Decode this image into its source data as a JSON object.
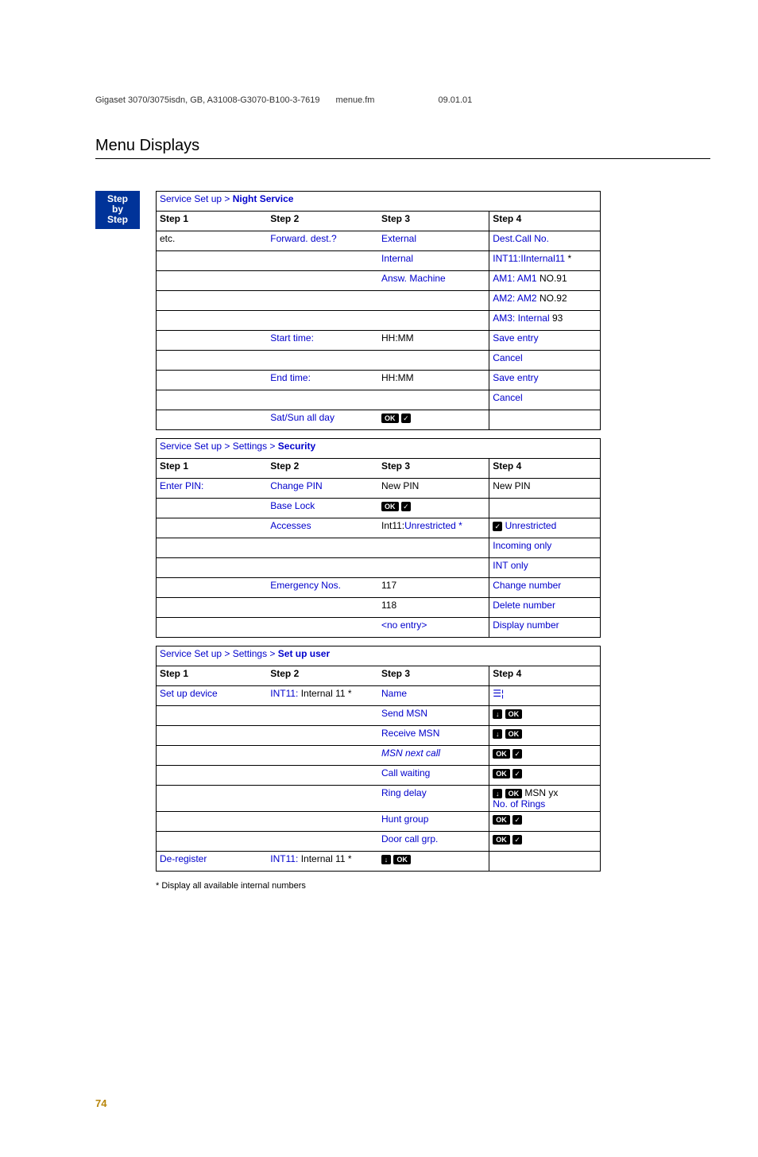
{
  "header": {
    "doc": "Gigaset 3070/3075isdn, GB, A31008-G3070-B100-3-7619",
    "file": "menue.fm",
    "date": "09.01.01"
  },
  "section_title": "Menu Displays",
  "badge": {
    "l1": "Step",
    "l2": "by",
    "l3": "Step"
  },
  "table1": {
    "title_a": "Service Set up > ",
    "title_b": "Night Service",
    "head": [
      "Step 1",
      "Step 2",
      "Step 3",
      "Step 4"
    ],
    "rows": [
      {
        "c1": "etc.",
        "c2": "Forward. dest.?",
        "c3": "External",
        "c4": "Dest.Call No."
      },
      {
        "c1": "",
        "c2": "",
        "c3": "Internal",
        "c4_a": "INT11:IInternal11 ",
        "c4_b": "*"
      },
      {
        "c1": "",
        "c2": "",
        "c3": "Answ. Machine",
        "c4_a": "AM1: AM1 ",
        "c4_b": "NO.91"
      },
      {
        "c1": "",
        "c2": "",
        "c3": "",
        "c4_a": "AM2: AM2 ",
        "c4_b": "NO.92"
      },
      {
        "c1": "",
        "c2": "",
        "c3": "",
        "c4_a": "AM3: Internal ",
        "c4_b": "93"
      },
      {
        "c1": "",
        "c2": "Start time:",
        "c3": "HH:MM",
        "c4": "Save entry"
      },
      {
        "c1": "",
        "c2": "",
        "c3": "",
        "c4": "Cancel"
      },
      {
        "c1": "",
        "c2": "End time:",
        "c3": "HH:MM",
        "c4": "Save entry"
      },
      {
        "c1": "",
        "c2": "",
        "c3": "",
        "c4": "Cancel"
      },
      {
        "c1": "",
        "c2": "Sat/Sun all day",
        "c3_icon": "okcheck",
        "c4": ""
      }
    ]
  },
  "table2": {
    "title_a": "Service Set up > Settings > ",
    "title_b": "Security",
    "head": [
      "Step 1",
      "Step 2",
      "Step 3",
      "Step 4"
    ],
    "rows": [
      {
        "c1": "Enter PIN:",
        "c2": "Change PIN",
        "c3": "New PIN",
        "c4": "New PIN"
      },
      {
        "c1": "",
        "c2": "Base Lock",
        "c3_icon": "okcheck",
        "c4": ""
      },
      {
        "c1": "",
        "c2": "Accesses",
        "c3_a": "Int11:",
        "c3_b": "Unrestricted *",
        "c4_pre": "check",
        "c4": " Unrestricted"
      },
      {
        "c1": "",
        "c2": "",
        "c3": "",
        "c4": "Incoming only"
      },
      {
        "c1": "",
        "c2": "",
        "c3": "",
        "c4": "INT only"
      },
      {
        "c1": "",
        "c2": "Emergency Nos.",
        "c3": "117",
        "c4": "Change number"
      },
      {
        "c1": "",
        "c2": "",
        "c3": "118",
        "c4": "Delete number"
      },
      {
        "c1": "",
        "c2": "",
        "c3": "<no entry>",
        "c4": "Display number"
      }
    ]
  },
  "table3": {
    "title_a": "Service Set up > Settings > ",
    "title_b": "Set up user",
    "head": [
      "Step 1",
      "Step 2",
      "Step 3",
      "Step 4"
    ],
    "rows": [
      {
        "c1": "Set up device",
        "c2_a": "INT11: ",
        "c2_b": "Internal 11 *",
        "c3": "Name",
        "c4_icon": "texticon"
      },
      {
        "c1": "",
        "c2": "",
        "c3": "Send MSN",
        "c4_icon": "arrowok"
      },
      {
        "c1": "",
        "c2": "",
        "c3": "Receive MSN",
        "c4_icon": "arrowok"
      },
      {
        "c1": "",
        "c2": "",
        "c3_i": "MSN next call",
        "c4_icon": "okcheck"
      },
      {
        "c1": "",
        "c2": "",
        "c3": "Call waiting",
        "c4_icon": "okcheck"
      },
      {
        "c1": "",
        "c2": "",
        "c3": "Ring delay",
        "c4_icon": "arrowok",
        "c4_a": " MSN yx",
        "c4_b": "No. of Rings"
      },
      {
        "c1": "",
        "c2": "",
        "c3": "Hunt group",
        "c4_icon": "okcheck"
      },
      {
        "c1": "",
        "c2": "",
        "c3": "Door call grp.",
        "c4_icon": "okcheck"
      },
      {
        "c1": "De-register",
        "c2_a": "INT11: ",
        "c2_b": "Internal 11 *",
        "c3_icon": "arrowok",
        "c4": ""
      }
    ]
  },
  "footnote": "*   Display all available internal numbers",
  "page_num": "74"
}
